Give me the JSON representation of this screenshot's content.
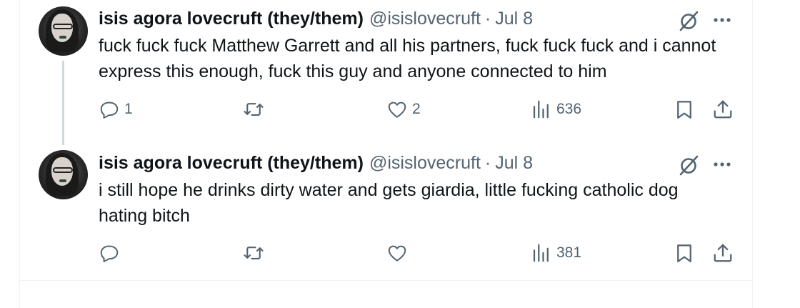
{
  "tweets": [
    {
      "author_name": "isis agora lovecruft (they/them)",
      "handle": "@isislovecruft",
      "separator": "·",
      "date": "Jul 8",
      "text": "fuck fuck fuck Matthew Garrett and all his partners, fuck fuck fuck and i cannot express this enough, fuck this guy and anyone connected to him",
      "reply_count": "1",
      "retweet_count": "",
      "like_count": "2",
      "view_count": "636"
    },
    {
      "author_name": "isis agora lovecruft (they/them)",
      "handle": "@isislovecruft",
      "separator": "·",
      "date": "Jul 8",
      "text": "i still hope he drinks dirty water and gets giardia, little fucking catholic dog hating bitch",
      "reply_count": "",
      "retweet_count": "",
      "like_count": "",
      "view_count": "381"
    }
  ],
  "icons": {
    "reply": "reply-icon",
    "retweet": "retweet-icon",
    "like": "heart-icon",
    "views": "analytics-icon",
    "bookmark": "bookmark-icon",
    "share": "share-icon",
    "grok": "grok-icon",
    "more": "more-icon"
  },
  "colors": {
    "text_primary": "#0f1419",
    "text_secondary": "#536471",
    "divider": "#eff3f4",
    "thread_line": "#cfd9de"
  }
}
